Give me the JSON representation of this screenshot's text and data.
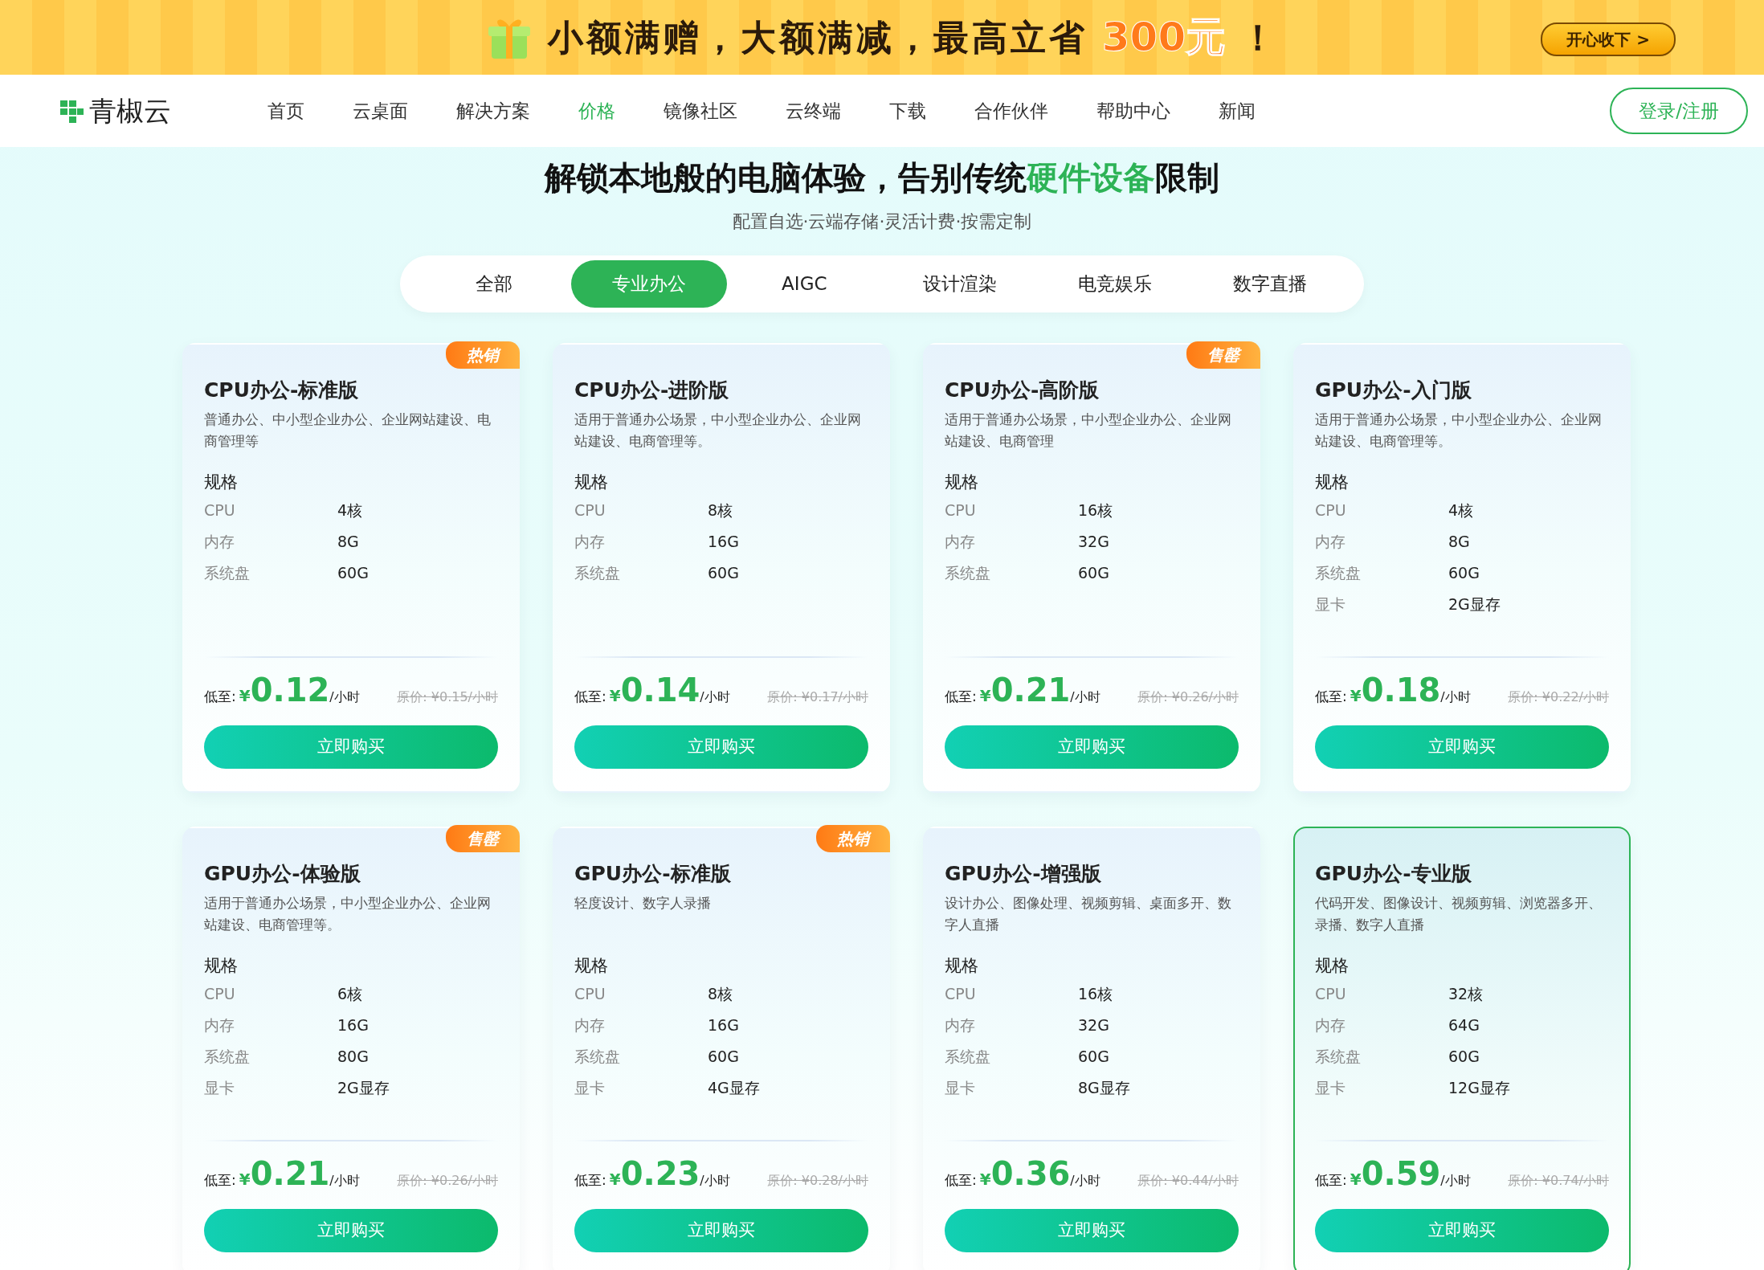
{
  "banner": {
    "headline": "小额满赠，大额满减，最高立省",
    "amount": "300元",
    "exclaim": "！",
    "button": "开心收下 >"
  },
  "nav": {
    "logo": "青椒云",
    "items": [
      {
        "label": "首页",
        "selected": false
      },
      {
        "label": "云桌面",
        "selected": false
      },
      {
        "label": "解决方案",
        "selected": false
      },
      {
        "label": "价格",
        "selected": true
      },
      {
        "label": "镜像社区",
        "selected": false
      },
      {
        "label": "云终端",
        "selected": false
      },
      {
        "label": "下载",
        "selected": false
      },
      {
        "label": "合作伙伴",
        "selected": false
      },
      {
        "label": "帮助中心",
        "selected": false
      },
      {
        "label": "新闻",
        "selected": false
      }
    ],
    "login": "登录/注册"
  },
  "hero": {
    "title": "解锁本地般的电脑体验，告别传统**硬件设备**限制",
    "subtitle": "配置自选·云端存储·灵活计费·按需定制"
  },
  "tabs": [
    {
      "label": "全部",
      "selected": false
    },
    {
      "label": "专业办公",
      "selected": true
    },
    {
      "label": "AIGC",
      "selected": false
    },
    {
      "label": "设计渲染",
      "selected": false
    },
    {
      "label": "电竞娱乐",
      "selected": false
    },
    {
      "label": "数字直播",
      "selected": false
    }
  ],
  "cards": [
    {
      "badge": "热销",
      "title": "CPU办公-标准版",
      "desc": "普通办公、中小型企业办公、企业网站建设、电商管理等",
      "spec_heading": "规格",
      "specs": [
        [
          "CPU",
          "4核"
        ],
        [
          "内存",
          "8G"
        ],
        [
          "系统盘",
          "60G"
        ]
      ],
      "price_label": "低至:",
      "currency": "¥",
      "price": "0.12",
      "unit": "/小时",
      "original": "原价: ¥0.15/小时",
      "button": "立即购买",
      "selected": false
    },
    {
      "title": "CPU办公-进阶版",
      "desc": "适用于普通办公场景，中小型企业办公、企业网站建设、电商管理等。",
      "spec_heading": "规格",
      "specs": [
        [
          "CPU",
          "8核"
        ],
        [
          "内存",
          "16G"
        ],
        [
          "系统盘",
          "60G"
        ]
      ],
      "price_label": "低至:",
      "currency": "¥",
      "price": "0.14",
      "unit": "/小时",
      "original": "原价: ¥0.17/小时",
      "button": "立即购买",
      "selected": false
    },
    {
      "badge": "售罄",
      "title": "CPU办公-高阶版",
      "desc": "适用于普通办公场景，中小型企业办公、企业网站建设、电商管理",
      "spec_heading": "规格",
      "specs": [
        [
          "CPU",
          "16核"
        ],
        [
          "内存",
          "32G"
        ],
        [
          "系统盘",
          "60G"
        ]
      ],
      "price_label": "低至:",
      "currency": "¥",
      "price": "0.21",
      "unit": "/小时",
      "original": "原价: ¥0.26/小时",
      "button": "立即购买",
      "selected": false
    },
    {
      "title": "GPU办公-入门版",
      "desc": "适用于普通办公场景，中小型企业办公、企业网站建设、电商管理等。",
      "spec_heading": "规格",
      "specs": [
        [
          "CPU",
          "4核"
        ],
        [
          "内存",
          "8G"
        ],
        [
          "系统盘",
          "60G"
        ],
        [
          "显卡",
          "2G显存"
        ]
      ],
      "price_label": "低至:",
      "currency": "¥",
      "price": "0.18",
      "unit": "/小时",
      "original": "原价: ¥0.22/小时",
      "button": "立即购买",
      "selected": false
    },
    {
      "badge": "售罄",
      "title": "GPU办公-体验版",
      "desc": "适用于普通办公场景，中小型企业办公、企业网站建设、电商管理等。",
      "spec_heading": "规格",
      "specs": [
        [
          "CPU",
          "6核"
        ],
        [
          "内存",
          "16G"
        ],
        [
          "系统盘",
          "80G"
        ],
        [
          "显卡",
          "2G显存"
        ]
      ],
      "price_label": "低至:",
      "currency": "¥",
      "price": "0.21",
      "unit": "/小时",
      "original": "原价: ¥0.26/小时",
      "button": "立即购买",
      "selected": false
    },
    {
      "badge": "热销",
      "title": "GPU办公-标准版",
      "desc": "轻度设计、数字人录播",
      "spec_heading": "规格",
      "specs": [
        [
          "CPU",
          "8核"
        ],
        [
          "内存",
          "16G"
        ],
        [
          "系统盘",
          "60G"
        ],
        [
          "显卡",
          "4G显存"
        ]
      ],
      "price_label": "低至:",
      "currency": "¥",
      "price": "0.23",
      "unit": "/小时",
      "original": "原价: ¥0.28/小时",
      "button": "立即购买",
      "selected": false
    },
    {
      "title": "GPU办公-增强版",
      "desc": "设计办公、图像处理、视频剪辑、桌面多开、数字人直播",
      "spec_heading": "规格",
      "specs": [
        [
          "CPU",
          "16核"
        ],
        [
          "内存",
          "32G"
        ],
        [
          "系统盘",
          "60G"
        ],
        [
          "显卡",
          "8G显存"
        ]
      ],
      "price_label": "低至:",
      "currency": "¥",
      "price": "0.36",
      "unit": "/小时",
      "original": "原价: ¥0.44/小时",
      "button": "立即购买",
      "selected": false
    },
    {
      "title": "GPU办公-专业版",
      "desc": "代码开发、图像设计、视频剪辑、浏览器多开、录播、数字人直播",
      "spec_heading": "规格",
      "specs": [
        [
          "CPU",
          "32核"
        ],
        [
          "内存",
          "64G"
        ],
        [
          "系统盘",
          "60G"
        ],
        [
          "显卡",
          "12G显存"
        ]
      ],
      "price_label": "低至:",
      "currency": "¥",
      "price": "0.59",
      "unit": "/小时",
      "original": "原价: ¥0.74/小时",
      "button": "立即购买",
      "selected": true
    }
  ]
}
